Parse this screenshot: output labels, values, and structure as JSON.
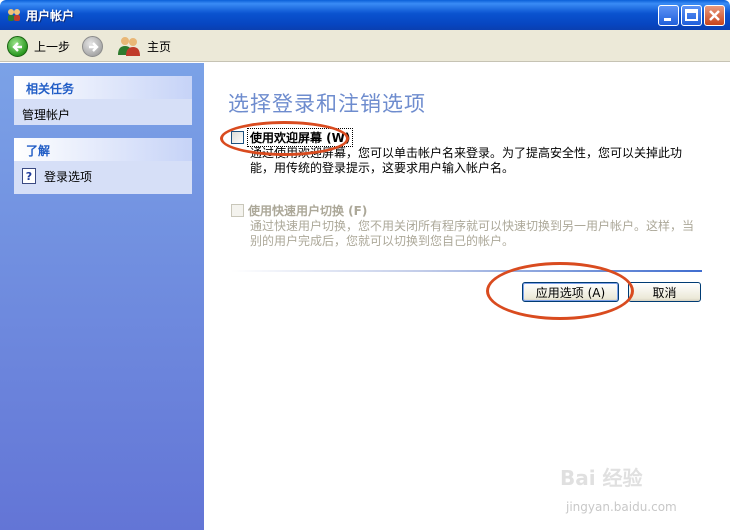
{
  "window": {
    "title": "用户帐户"
  },
  "toolbar": {
    "back_label": "上一步",
    "forward_label": "",
    "home_label": "主页"
  },
  "sidebar": {
    "related_tasks_heading": "相关任务",
    "related_tasks_items": [
      {
        "label": "管理帐户"
      }
    ],
    "learn_heading": "了解",
    "learn_items": [
      {
        "label": "登录选项",
        "icon": "help-icon"
      }
    ]
  },
  "main": {
    "title": "选择登录和注销选项",
    "option_welcome": {
      "label": "使用欢迎屏幕 (W)",
      "checked": false,
      "enabled": true,
      "desc_line1": "通过使用欢迎屏幕，您可以单击帐户名来登录。为了提高安全性，您可以关掉此功",
      "desc_line2": "能，用传统的登录提示，这要求用户输入帐户名。"
    },
    "option_fast_switch": {
      "label": "使用快速用户切换 (F)",
      "checked": false,
      "enabled": false,
      "desc_line1": "通过快速用户切换，您不用关闭所有程序就可以快速切换到另一用户帐户。这样，当",
      "desc_line2": "别的用户完成后，您就可以切换到您自己的帐户。"
    },
    "apply_label": "应用选项 (A)",
    "cancel_label": "取消"
  },
  "watermark": {
    "brand": "Bai 经验",
    "url": "jingyan.baidu.com"
  },
  "colors": {
    "title_bar": "#0a53d0",
    "sidebar_gradient_top": "#7ba2e7",
    "sidebar_gradient_bottom": "#6375d6",
    "heading": "#6e8cce",
    "annotation": "#d94b1f"
  }
}
